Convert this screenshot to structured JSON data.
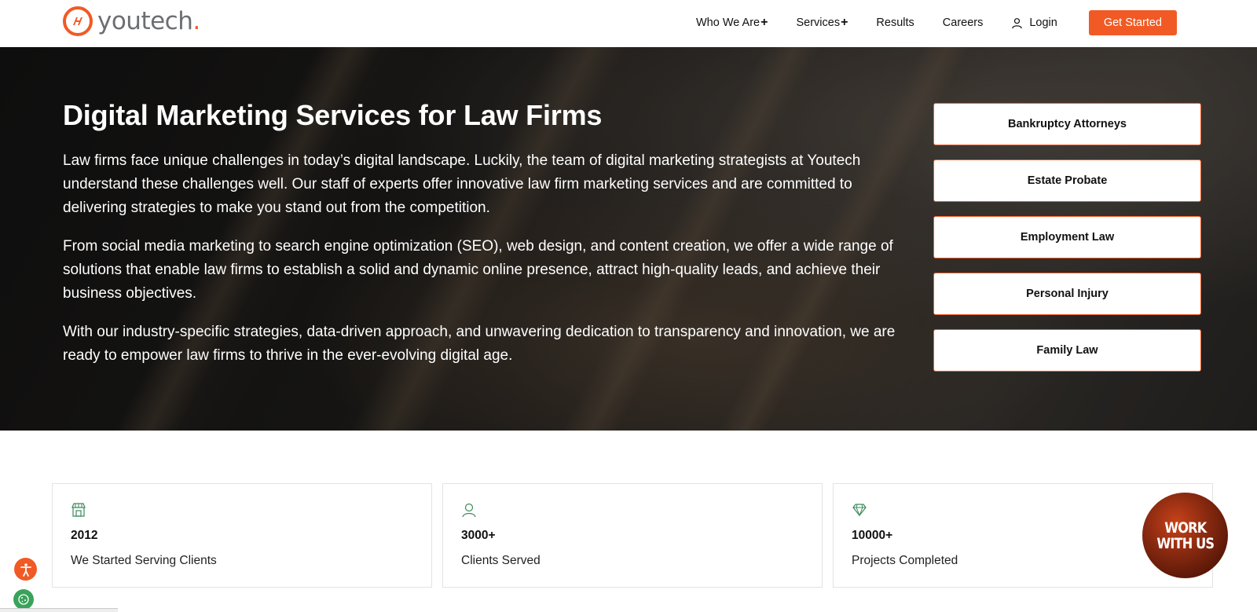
{
  "header": {
    "logo_text": "youtech",
    "logo_dot": ".",
    "nav": [
      {
        "label": "Who We Are",
        "suffix": "+"
      },
      {
        "label": "Services",
        "suffix": "+"
      },
      {
        "label": "Results",
        "suffix": ""
      },
      {
        "label": "Careers",
        "suffix": ""
      }
    ],
    "login_label": "Login",
    "cta_label": "Get Started"
  },
  "hero": {
    "title": "Digital Marketing Services for Law Firms",
    "paragraphs": [
      "Law firms face unique challenges in today’s digital landscape. Luckily, the team of digital marketing strategists at Youtech understand these challenges well. Our staff of experts offer innovative law firm marketing services and are committed to delivering strategies to make you stand out from the competition.",
      "From social media marketing to search engine optimization (SEO), web design, and content creation, we offer a wide range of solutions that enable law firms to establish a solid and dynamic online presence, attract high-quality leads, and achieve their business objectives.",
      "With our industry-specific strategies, data-driven approach, and unwavering dedication to transparency and innovation, we are ready to empower law firms to thrive in the ever-evolving digital age."
    ],
    "practice_areas": [
      "Bankruptcy Attorneys",
      "Estate Probate",
      "Employment Law",
      "Personal Injury",
      "Family Law"
    ]
  },
  "stats": [
    {
      "icon": "store-icon",
      "value": "2012",
      "label": "We Started Serving Clients"
    },
    {
      "icon": "user-icon",
      "value": "3000+",
      "label": "Clients Served"
    },
    {
      "icon": "diamond-icon",
      "value": "10000+",
      "label": "Projects Completed"
    }
  ],
  "work_badge": {
    "line1": "WORK",
    "line2": "WITH US"
  },
  "colors": {
    "accent": "#f15a24",
    "text": "#111111",
    "card_border": "#e3e3e3"
  }
}
